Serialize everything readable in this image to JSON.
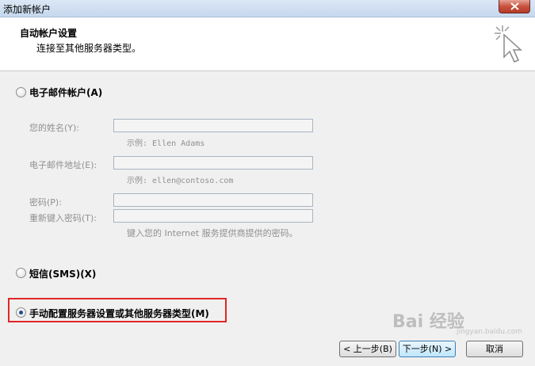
{
  "window": {
    "title": "添加新帐户"
  },
  "header": {
    "title": "自动帐户设置",
    "subtitle": "连接至其他服务器类型。"
  },
  "options": {
    "email_account": {
      "label": "电子邮件帐户(A)",
      "selected": false
    },
    "sms": {
      "label": "短信(SMS)(X)",
      "selected": false
    },
    "manual": {
      "label": "手动配置服务器设置或其他服务器类型(M)",
      "selected": true
    }
  },
  "fields": {
    "name": {
      "label": "您的姓名(Y):",
      "value": "",
      "hint": "示例: Ellen Adams"
    },
    "email": {
      "label": "电子邮件地址(E):",
      "value": "",
      "hint": "示例: ellen@contoso.com"
    },
    "password": {
      "label": "密码(P):",
      "value": ""
    },
    "password_confirm": {
      "label": "重新键入密码(T):",
      "value": "",
      "hint": "键入您的 Internet 服务提供商提供的密码。"
    }
  },
  "buttons": {
    "back": "< 上一步(B)",
    "next": "下一步(N) >",
    "cancel": "取消"
  },
  "watermark": {
    "text": "Bai 经验",
    "sub": "jingyan.baidu.com"
  },
  "colors": {
    "highlight": "#e02727",
    "radio_dot": "#1d4d8a"
  }
}
